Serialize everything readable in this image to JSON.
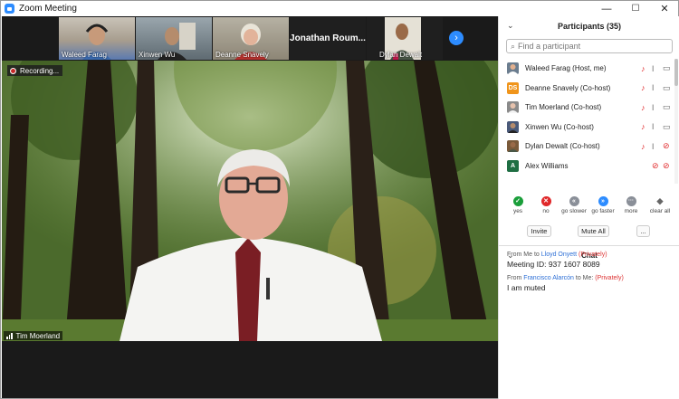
{
  "window": {
    "title": "Zoom Meeting",
    "controls": {
      "minimize": "—",
      "maximize": "☐",
      "close": "✕"
    }
  },
  "gallery": [
    {
      "name": "Waleed Farag",
      "type": "video"
    },
    {
      "name": "Xinwen Wu",
      "type": "video"
    },
    {
      "name": "Deanne Snavely",
      "type": "video"
    },
    {
      "name": "Jonathan Roum...",
      "type": "name-only"
    },
    {
      "name": "Dylan Dewalt",
      "type": "video"
    }
  ],
  "recording": {
    "label": "Recording..."
  },
  "speaker": {
    "name": "Tim Moerland"
  },
  "participants": {
    "title": "Participants (35)",
    "search_placeholder": "Find a participant",
    "list": [
      {
        "name": "Waleed Farag (Host, me)",
        "avatar": "photo",
        "avatar_color": "#6b7d8f",
        "audio": "unmuted",
        "video": "on"
      },
      {
        "name": "Deanne Snavely (Co-host)",
        "avatar": "DS",
        "avatar_color": "#f0951b",
        "audio": "unmuted",
        "video": "on"
      },
      {
        "name": "Tim Moerland (Co-host)",
        "avatar": "photo",
        "avatar_color": "#8a8a8a",
        "audio": "unmuted",
        "video": "on"
      },
      {
        "name": "Xinwen Wu (Co-host)",
        "avatar": "photo",
        "avatar_color": "#4a5a7a",
        "audio": "unmuted",
        "video": "on"
      },
      {
        "name": "Dylan Dewalt (Co-host)",
        "avatar": "photo",
        "avatar_color": "#7a5a3a",
        "audio": "unmuted",
        "video": "off"
      },
      {
        "name": "Alex Williams",
        "avatar": "A",
        "avatar_color": "#1f6e43",
        "audio": "muted",
        "video": "off"
      }
    ],
    "reactions": [
      {
        "label": "yes",
        "color": "#1a9e3a",
        "symbol": "✓"
      },
      {
        "label": "no",
        "color": "#e0282a",
        "symbol": "✕"
      },
      {
        "label": "go slower",
        "color": "#8a8f98",
        "symbol": "«"
      },
      {
        "label": "go faster",
        "color": "#2d8cff",
        "symbol": "»"
      },
      {
        "label": "more",
        "color": "#8a8f98",
        "symbol": "···"
      },
      {
        "label": "clear all",
        "color": "#666666",
        "symbol": "◆"
      }
    ],
    "buttons": {
      "invite": "Invite",
      "mute_all": "Mute All",
      "more": "..."
    }
  },
  "chat": {
    "title": "Chat",
    "messages": [
      {
        "from": "From Me to",
        "to": "Lloyd Onyett",
        "privacy": "(Privately)",
        "text": "Meeting ID: 937 1607 8089"
      },
      {
        "from": "From",
        "sender": "Francisco Alarcón",
        "to_label": "to Me:",
        "privacy": "(Privately)",
        "text": "I am muted"
      }
    ]
  },
  "colors": {
    "accent": "#2d8cff",
    "muted_red": "#e0282a",
    "private": "#dd3333"
  }
}
